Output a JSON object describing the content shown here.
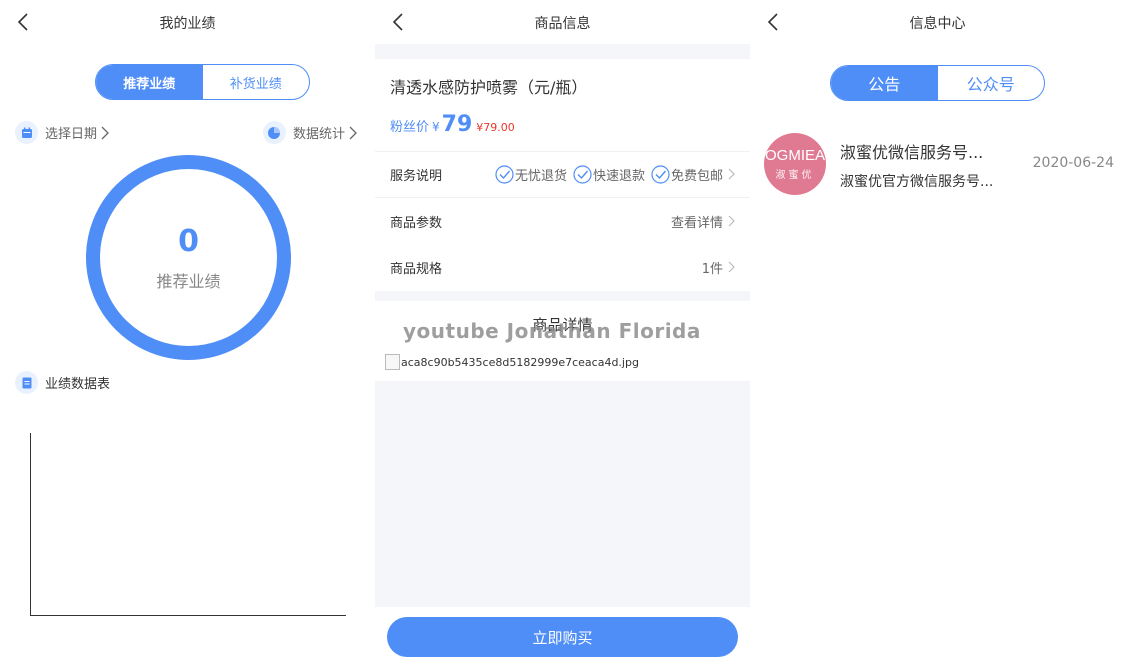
{
  "colors": {
    "accent": "#4f8ef7",
    "price_red": "#e8382b",
    "band": "#f4f6fa"
  },
  "panel1": {
    "nav": {
      "title": "我的业绩",
      "back_icon": "chevron-left-icon"
    },
    "tabs": [
      {
        "label": "推荐业绩",
        "active": true
      },
      {
        "label": "补货业绩",
        "active": false
      }
    ],
    "select_date": {
      "label": "选择日期",
      "icon": "calendar-icon"
    },
    "data_stats": {
      "label": "数据统计",
      "icon": "pie-chart-icon"
    },
    "ring": {
      "value": "0",
      "label": "推荐业绩"
    },
    "table_header": {
      "label": "业绩数据表",
      "icon": "document-icon"
    }
  },
  "panel2": {
    "nav": {
      "title": "商品信息",
      "back_icon": "chevron-left-icon"
    },
    "product": {
      "title": "清透水感防护喷雾（元/瓶）",
      "fan_price_label": "粉丝价",
      "currency": "¥",
      "price": "79",
      "original_price": "¥79.00"
    },
    "service": {
      "label": "服务说明",
      "items": [
        "无忧退货",
        "快速退款",
        "免费包邮"
      ]
    },
    "params": {
      "label": "商品参数",
      "value": "查看详情"
    },
    "spec": {
      "label": "商品规格",
      "value": "1件"
    },
    "detail_title": "商品详情",
    "watermark": "youtube Jonathan Florida",
    "broken_image_alt": "aca8c90b5435ce8d5182999e7ceaca4d.jpg",
    "buy_button": "立即购买"
  },
  "panel3": {
    "nav": {
      "title": "信息中心",
      "back_icon": "chevron-left-icon"
    },
    "tabs": [
      {
        "label": "公告",
        "active": true
      },
      {
        "label": "公众号",
        "active": false
      }
    ],
    "message": {
      "avatar_text": "OGMIEA",
      "avatar_sub": "淑蜜优",
      "title": "淑蜜优微信服务号...",
      "subtitle": "淑蜜优官方微信服务号...",
      "date": "2020-06-24"
    }
  }
}
